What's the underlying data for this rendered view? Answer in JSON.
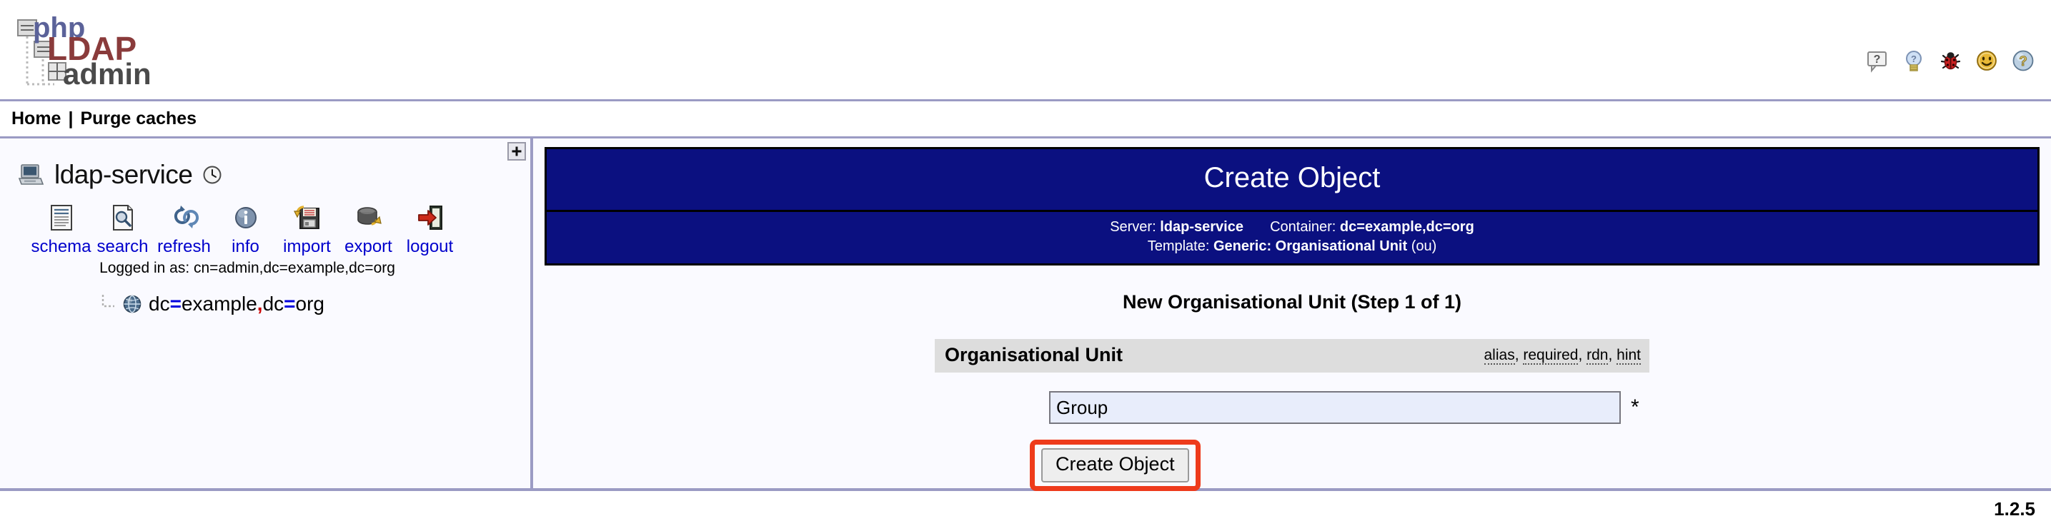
{
  "app": {
    "logo_text_1": "php",
    "logo_text_2": "LDAP",
    "logo_text_3": "admin",
    "version": "1.2.5"
  },
  "header": {
    "icons": [
      {
        "name": "question-bubble-icon",
        "title": "?"
      },
      {
        "name": "lightbulb-hint-icon",
        "title": "?"
      },
      {
        "name": "bug-report-icon",
        "title": "bug"
      },
      {
        "name": "smiley-icon",
        "title": ":)"
      },
      {
        "name": "help-orb-icon",
        "title": "?"
      }
    ]
  },
  "breadcrumb": {
    "home": "Home",
    "separator": "|",
    "purge": "Purge caches"
  },
  "sidebar": {
    "expander_label": "+",
    "server_name": "ldap-service",
    "clock_icon": "clock-icon",
    "tools": [
      {
        "label": "schema",
        "icon": "schema-document-icon"
      },
      {
        "label": "search",
        "icon": "search-document-icon"
      },
      {
        "label": "refresh",
        "icon": "refresh-arrows-icon"
      },
      {
        "label": "info",
        "icon": "info-circle-icon"
      },
      {
        "label": "import",
        "icon": "import-floppy-icon"
      },
      {
        "label": "export",
        "icon": "export-database-icon"
      },
      {
        "label": "logout",
        "icon": "logout-door-icon"
      }
    ],
    "logged_in_as": "Logged in as: cn=admin,dc=example,dc=org",
    "tree": [
      {
        "label": "dc=example,dc=org",
        "icon": "globe-icon"
      }
    ]
  },
  "main": {
    "panel_title": "Create Object",
    "server_label": "Server:",
    "server_value": "ldap-service",
    "container_label": "Container:",
    "container_value": "dc=example,dc=org",
    "template_label": "Template:",
    "template_value": "Generic: Organisational Unit",
    "template_suffix": "(ou)",
    "step_title": "New Organisational Unit (Step 1 of 1)",
    "form": {
      "section_label": "Organisational Unit",
      "links": [
        {
          "label": "alias"
        },
        {
          "label": "required"
        },
        {
          "label": "rdn"
        },
        {
          "label": "hint"
        }
      ],
      "links_separator": ", ",
      "field_value": "Group",
      "field_placeholder": "",
      "required_marker": "*",
      "submit_label": "Create Object"
    }
  },
  "colors": {
    "panel_blue": "#0b1080",
    "border_lavender": "#9b9bc4",
    "link_blue": "#0000cc",
    "highlight_red": "#ee3b1c",
    "form_head_gray": "#dddddd",
    "input_bg": "#e8edfb"
  }
}
